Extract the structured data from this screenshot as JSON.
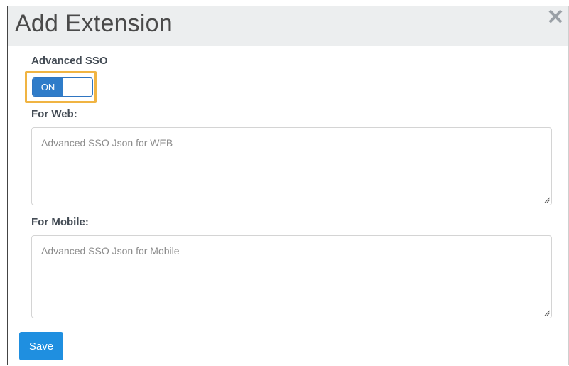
{
  "dialog": {
    "title": "Add Extension",
    "close_icon": "close-icon"
  },
  "form": {
    "advanced_sso_label": "Advanced SSO",
    "toggle": {
      "state_label": "ON",
      "checked": true
    },
    "web": {
      "label": "For Web:",
      "placeholder": "Advanced SSO Json for WEB",
      "value": ""
    },
    "mobile": {
      "label": "For Mobile:",
      "placeholder": "Advanced SSO Json for Mobile",
      "value": ""
    },
    "save_label": "Save"
  },
  "colors": {
    "highlight": "#f0b443",
    "toggle_on": "#2f7cc9",
    "save_button": "#1f8fe0",
    "header_bg": "#eceeef"
  }
}
